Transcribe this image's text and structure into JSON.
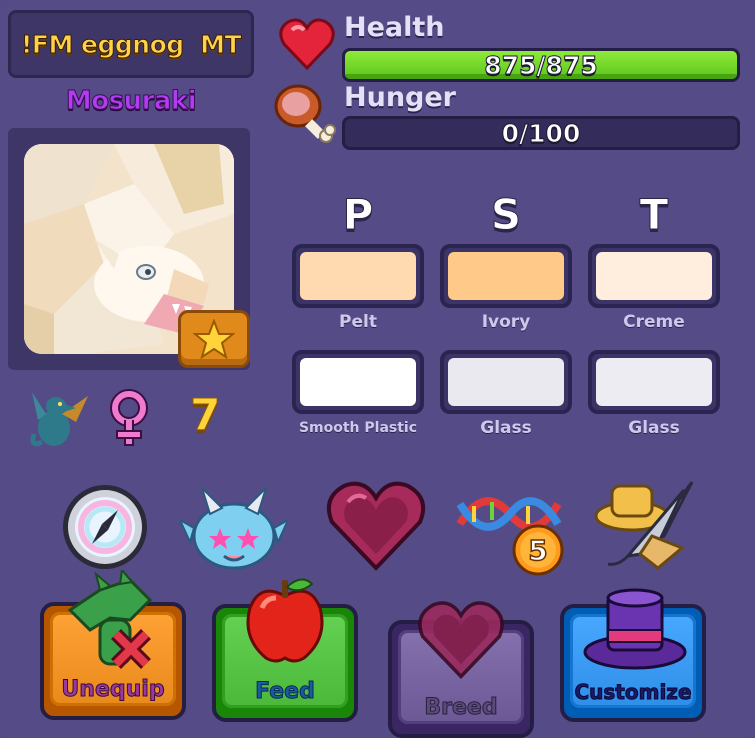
{
  "dragon": {
    "nickname": "!FM eggnog  MT",
    "species": "Mosuraki",
    "level": "7",
    "gender_icon": "female-icon"
  },
  "stats": {
    "health": {
      "label": "Health",
      "value_text": "875/875",
      "fraction": 1.0,
      "color": "#6fd62a"
    },
    "hunger": {
      "label": "Hunger",
      "value_text": "0/100",
      "fraction": 0.0
    }
  },
  "genes": {
    "headers": [
      "P",
      "S",
      "T"
    ],
    "row1": [
      {
        "name": "Pelt",
        "color": "#ffd9b0"
      },
      {
        "name": "Ivory",
        "color": "#ffc98a"
      },
      {
        "name": "Creme",
        "color": "#ffeedd"
      }
    ],
    "row2": [
      {
        "name": "Smooth Plastic",
        "color": "#ffffff"
      },
      {
        "name": "Glass",
        "color": "#e9e9ef"
      },
      {
        "name": "Glass",
        "color": "#ececf2"
      }
    ]
  },
  "items": [
    "compass-icon",
    "baby-dragon-face-icon",
    "heart-gem-icon",
    "dna-five-icon",
    "quill-hat-icon"
  ],
  "actions": {
    "unequip": {
      "label": "Unequip",
      "color": "#e8891c"
    },
    "feed": {
      "label": "Feed",
      "color": "#4bb83a"
    },
    "breed": {
      "label": "Breed",
      "color": "#6b5894"
    },
    "customize": {
      "label": "Customize",
      "color": "#2f8fe8"
    }
  }
}
